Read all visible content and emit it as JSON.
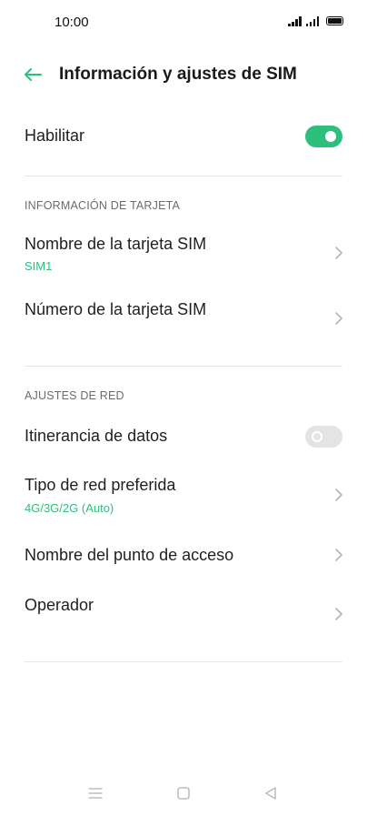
{
  "status_bar": {
    "time": "10:00"
  },
  "header": {
    "back_icon": "arrow-left-icon",
    "title": "Información y ajustes de SIM"
  },
  "enable_row": {
    "label": "Habilitar",
    "toggle_on": true
  },
  "card_info": {
    "section_title": "INFORMACIÓN DE TARJETA",
    "items": [
      {
        "label": "Nombre de la tarjeta SIM",
        "value": "SIM1"
      },
      {
        "label": "Número de la tarjeta SIM"
      }
    ]
  },
  "network": {
    "section_title": "AJUSTES DE RED",
    "data_roaming": {
      "label": "Itinerancia de datos",
      "toggle_on": false
    },
    "items": [
      {
        "label": "Tipo de red preferida",
        "value": "4G/3G/2G (Auto)"
      },
      {
        "label": "Nombre del punto de acceso"
      },
      {
        "label": "Operador"
      }
    ]
  },
  "colors": {
    "accent": "#2dbf7c",
    "toggle_off": "#e4e4e4",
    "divider": "#e6e6e6"
  },
  "nav_bar": {
    "icons": [
      "menu-icon",
      "square-icon",
      "back-triangle-icon"
    ]
  }
}
